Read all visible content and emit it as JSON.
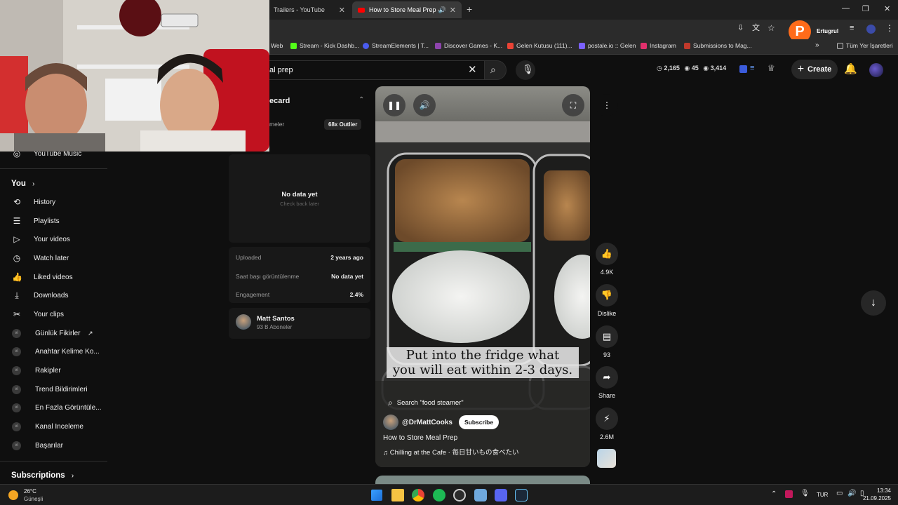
{
  "browser": {
    "tabs": [
      {
        "label": "Trailers - YouTube"
      },
      {
        "label": "How to Store Meal Prep - Yo"
      }
    ],
    "profile_letter": "P",
    "profile_badge": "Ertugrul",
    "bookmarks": [
      {
        "label": "Web",
        "color": "#888888"
      },
      {
        "label": "Stream - Kick Dashb...",
        "color": "#53fc18"
      },
      {
        "label": "StreamElements | T...",
        "color": "#4a5cf0"
      },
      {
        "label": "Discover Games - K...",
        "color": "#8e44ad"
      },
      {
        "label": "Gelen Kutusu (111)...",
        "color": "#ea4335"
      },
      {
        "label": "postale.io :: Gelen",
        "color": "#7b61ff"
      },
      {
        "label": "Instagram",
        "color": "#e1306c"
      },
      {
        "label": "Submissions to Mag...",
        "color": "#c0392b"
      },
      {
        "label": "Tüm Yer İşaretleri",
        "color": "#bbbbbb"
      }
    ]
  },
  "header": {
    "search_text": "al prep",
    "stats": {
      "views": "2,165",
      "eye1": "45",
      "eye2": "3,414"
    },
    "create_label": "Create"
  },
  "sidebar": {
    "youtube_music": "YouTube Music",
    "you_label": "You",
    "you_items": [
      {
        "label": "History",
        "icon": "history-icon",
        "glyph": "⟲"
      },
      {
        "label": "Playlists",
        "icon": "playlists-icon",
        "glyph": "☰"
      },
      {
        "label": "Your videos",
        "icon": "your-videos-icon",
        "glyph": "▷"
      },
      {
        "label": "Watch later",
        "icon": "clock-icon",
        "glyph": "◷"
      },
      {
        "label": "Liked videos",
        "icon": "thumbs-up-icon",
        "glyph": "👍"
      },
      {
        "label": "Downloads",
        "icon": "download-icon",
        "glyph": "⤓"
      },
      {
        "label": "Your clips",
        "icon": "scissors-icon",
        "glyph": "✂"
      }
    ],
    "ext_items": [
      {
        "label": "Günlük Fikirler"
      },
      {
        "label": "Anahtar Kelime Ko..."
      },
      {
        "label": "Rakipler"
      },
      {
        "label": "Trend Bildirimleri"
      },
      {
        "label": "En Fazla Görüntüle..."
      },
      {
        "label": "Kanal Inceleme"
      },
      {
        "label": "Başarılar"
      }
    ],
    "subscriptions_label": "Subscriptions"
  },
  "panel": {
    "title": "ecard",
    "subtitle": "meler",
    "outlier": "68x Outlier",
    "no_data": "No data yet",
    "check_back": "Check back later",
    "rows": [
      {
        "label": "Uploaded",
        "value": "2 years ago"
      },
      {
        "label": "Saat başı görüntülenme",
        "value": "No data yet"
      },
      {
        "label": "Engagement",
        "value": "2.4%"
      }
    ],
    "channel_name": "Matt Santos",
    "channel_subs": "93 B Aboneler"
  },
  "video": {
    "caption_line1": "Put into the fridge what",
    "caption_line2": "you will eat within 2-3 days.",
    "search_suggestion": "Search \"food steamer\"",
    "channel_handle": "@DrMattCooks",
    "subscribe_label": "Subscribe",
    "title": "How to Store Meal Prep",
    "music": "Chilling at the Cafe · 毎日甘いもの食べたい"
  },
  "actions": {
    "likes": "4.9K",
    "dislike_label": "Dislike",
    "comments": "93",
    "share_label": "Share",
    "remix_count": "2.6M"
  },
  "taskbar": {
    "weather_temp": "26°C",
    "weather_desc": "Güneşli",
    "language": "TUR",
    "time": "13:34",
    "date": "21.09.2025"
  }
}
